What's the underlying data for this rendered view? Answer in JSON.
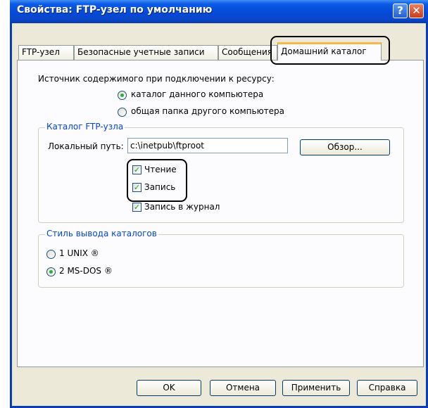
{
  "window": {
    "title": "Свойства: FTP-узел по умолчанию",
    "help_glyph": "?",
    "close_glyph": "✕"
  },
  "tabs": [
    {
      "label": "FTP-узел"
    },
    {
      "label": "Безопасные учетные записи"
    },
    {
      "label": "Сообщения"
    },
    {
      "label": "Домашний каталог",
      "active": true
    }
  ],
  "content_source": {
    "prompt": "Источник содержимого при подключении к ресурсу:",
    "options": [
      {
        "label": "каталог данного компьютера",
        "selected": true
      },
      {
        "label": "общая папка другого компьютера",
        "selected": false
      }
    ]
  },
  "ftp_dir": {
    "legend": "Каталог FTP-узла",
    "local_path_label": "Локальный путь:",
    "local_path_value": "c:\\inetpub\\ftproot",
    "browse_label": "Обзор...",
    "checkboxes": [
      {
        "label": "Чтение",
        "checked": true
      },
      {
        "label": "Запись",
        "checked": true
      },
      {
        "label": "Запись в журнал",
        "checked": true
      }
    ]
  },
  "listing_style": {
    "legend": "Стиль вывода каталогов",
    "options": [
      {
        "label": "1 UNIX ®",
        "selected": false
      },
      {
        "label": "2 MS-DOS ®",
        "selected": true
      }
    ]
  },
  "buttons": {
    "ok": "OK",
    "cancel": "Отмена",
    "apply": "Применить",
    "help": "Справка"
  },
  "check_glyph": "✓",
  "colors": {
    "titlebar": "#0a5ae6",
    "dialog_bg": "#ece9d8",
    "group_legend": "#0046d5",
    "check_mark": "#21a121"
  }
}
